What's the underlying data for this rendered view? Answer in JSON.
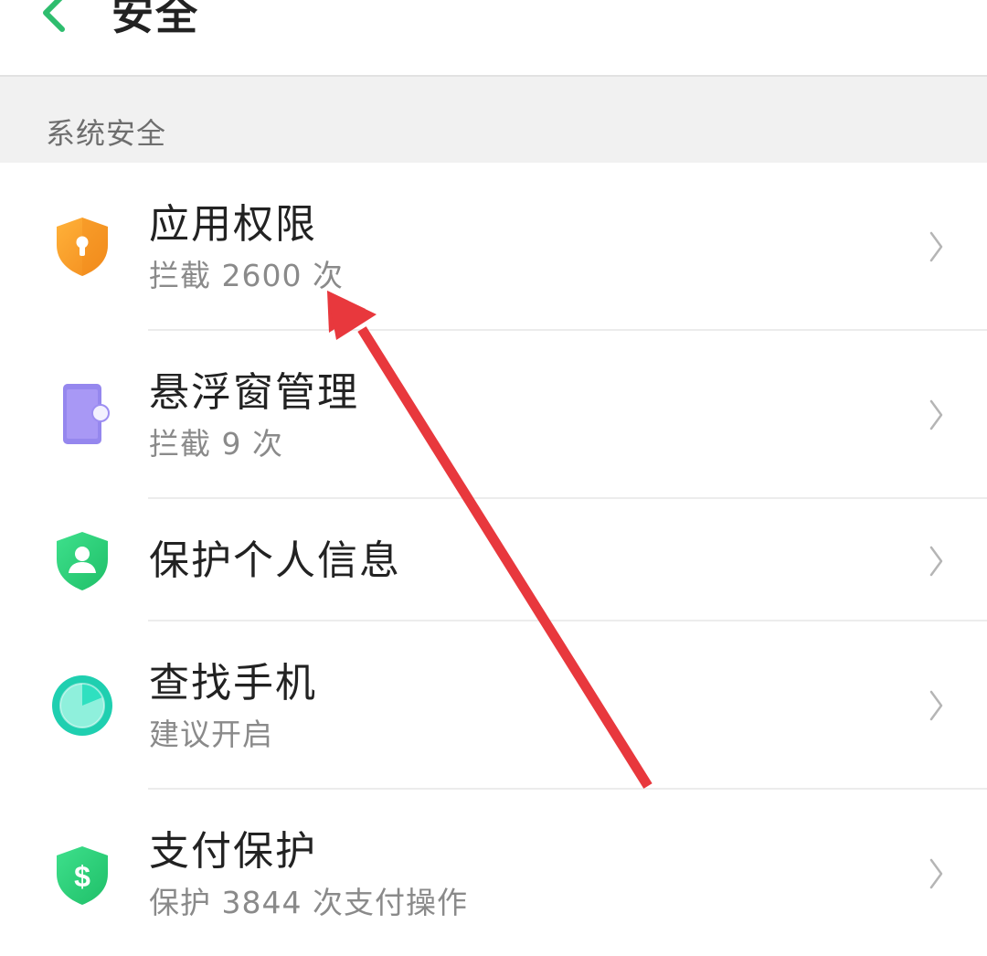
{
  "header": {
    "back_icon": "chevron-left-icon",
    "title": "安全",
    "accent_color": "#2ebd6e"
  },
  "section": {
    "title": "系统安全"
  },
  "items": [
    {
      "title": "应用权限",
      "subtitle": "拦截 2600 次",
      "icon": "shield-lock-icon",
      "icon_color": "#f5a12a"
    },
    {
      "title": "悬浮窗管理",
      "subtitle": "拦截 9 次",
      "icon": "floating-window-icon",
      "icon_color": "#9b8cf0"
    },
    {
      "title": "保护个人信息",
      "subtitle": "",
      "icon": "shield-person-icon",
      "icon_color": "#2fd07a"
    },
    {
      "title": "查找手机",
      "subtitle": "建议开启",
      "icon": "radar-icon",
      "icon_color": "#22d3b4"
    },
    {
      "title": "支付保护",
      "subtitle": "保护 3844 次支付操作",
      "icon": "shield-dollar-icon",
      "icon_color": "#2fd07a"
    }
  ],
  "annotation": {
    "icon": "red-arrow-icon",
    "color": "#e8383d"
  }
}
